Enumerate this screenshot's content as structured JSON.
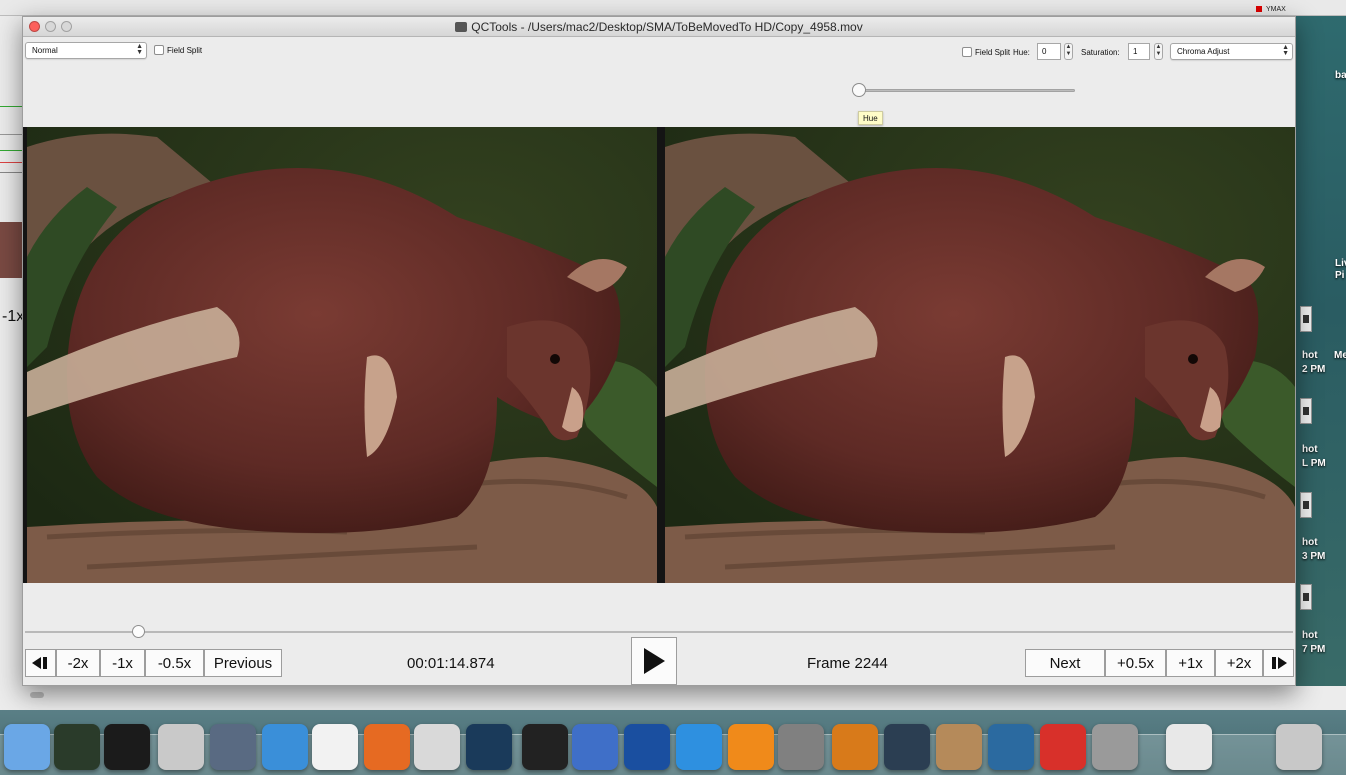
{
  "background": {
    "ymax_label": "YMAX",
    "left_label": "-1x",
    "desktop_labels": [
      "ba",
      "Liv",
      "Pi",
      "hot",
      "Me",
      "2 PM",
      "hot",
      "L PM",
      "hot",
      "3 PM",
      "hot",
      "7 PM"
    ]
  },
  "window": {
    "title": "QCTools - /Users/mac2/Desktop/SMA/ToBeMovedTo HD/Copy_4958.mov"
  },
  "toolbar": {
    "left_mode": "Normal",
    "left_field_split": "Field Split",
    "right_field_split": "Field Split",
    "hue_label": "Hue:",
    "hue_value": "0",
    "saturation_label": "Saturation:",
    "saturation_value": "1",
    "right_filter": "Chroma Adjust",
    "hue_tooltip": "Hue",
    "hue_level": 0
  },
  "playback": {
    "timeline_position": 0.09,
    "buttons_left": [
      "-2x",
      "-1x",
      "-0.5x",
      "Previous"
    ],
    "timecode": "00:01:14.874",
    "frame_label": "Frame 2244",
    "buttons_right": [
      "Next",
      "+0.5x",
      "+1x",
      "+2x"
    ]
  },
  "dock": {
    "icons": [
      "finder-icon",
      "activity-monitor-icon",
      "terminal-icon",
      "disk-utility-icon",
      "launchpad-icon",
      "safari-icon",
      "textedit-icon",
      "firefox-icon",
      "qctools-icon",
      "video-editor-icon",
      "clapper-icon",
      "quicktime-icon",
      "quicktime-x-icon",
      "quicktime-7-icon",
      "vlc-icon",
      "system-preferences-icon",
      "accessibility-icon",
      "speed-meter-icon",
      "reel-icon",
      "screenshot-icon",
      "pdf-icon",
      "instruments-icon",
      "documents-stack-icon",
      "trash-icon"
    ]
  }
}
